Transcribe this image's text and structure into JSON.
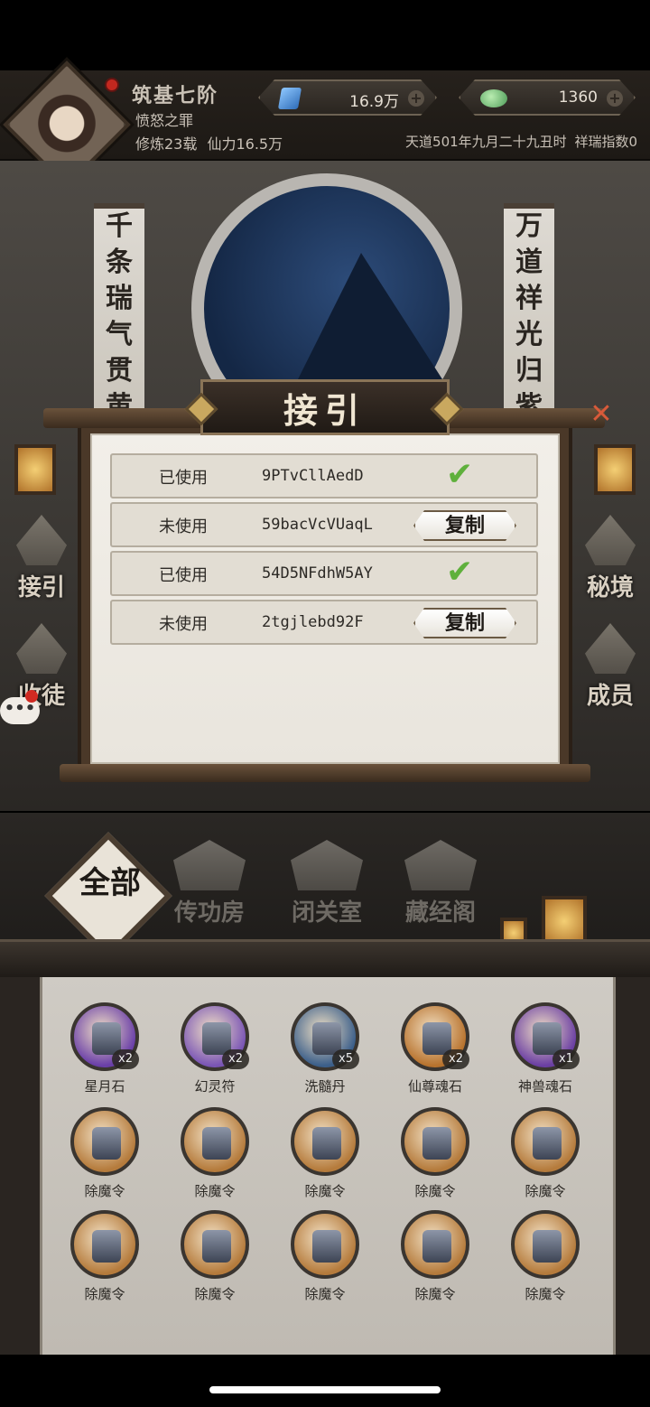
{
  "header": {
    "rank": "筑基七阶",
    "title": "愤怒之罪",
    "cultivation": "修炼23载",
    "power": "仙力16.5万",
    "date": "天道501年九月二十九丑时",
    "luck": "祥瑞指数0",
    "gems": "16.9万",
    "jade": "1360"
  },
  "scene": {
    "banner_left": [
      "千",
      "条",
      "瑞",
      "气",
      "贯",
      "黄"
    ],
    "banner_right": [
      "万",
      "道",
      "祥",
      "光",
      "归",
      "紫"
    ],
    "side_left": [
      "接引",
      "收徒"
    ],
    "side_right": [
      "秘境",
      "成员"
    ]
  },
  "dialog": {
    "title": "接引",
    "close": "✕",
    "rows": [
      {
        "status": "已使用",
        "code": "9PTvCllAedD",
        "used": true
      },
      {
        "status": "未使用",
        "code": "59bacVcVUaqL",
        "used": false
      },
      {
        "status": "已使用",
        "code": "54D5NFdhW5AY",
        "used": true
      },
      {
        "status": "未使用",
        "code": "2tgjlebd92F",
        "used": false
      }
    ],
    "copy_label": "复制",
    "check_icon": "✔"
  },
  "tabs": {
    "all": "全部",
    "items": [
      "传功房",
      "闭关室",
      "藏经阁"
    ]
  },
  "inventory": [
    {
      "name": "星月石",
      "count": "x2",
      "color": "#6a3fa8"
    },
    {
      "name": "幻灵符",
      "count": "x2",
      "color": "#7a55b5"
    },
    {
      "name": "洗髓丹",
      "count": "x5",
      "color": "#3c5f8a"
    },
    {
      "name": "仙尊魂石",
      "count": "x2",
      "color": "#b8732e"
    },
    {
      "name": "神兽魂石",
      "count": "x1",
      "color": "#6b3fa3"
    },
    {
      "name": "除魔令",
      "count": "",
      "color": "#b57b3c"
    },
    {
      "name": "除魔令",
      "count": "",
      "color": "#b57b3c"
    },
    {
      "name": "除魔令",
      "count": "",
      "color": "#b57b3c"
    },
    {
      "name": "除魔令",
      "count": "",
      "color": "#b57b3c"
    },
    {
      "name": "除魔令",
      "count": "",
      "color": "#b57b3c"
    },
    {
      "name": "除魔令",
      "count": "",
      "color": "#b57b3c"
    },
    {
      "name": "除魔令",
      "count": "",
      "color": "#b57b3c"
    },
    {
      "name": "除魔令",
      "count": "",
      "color": "#b57b3c"
    },
    {
      "name": "除魔令",
      "count": "",
      "color": "#b57b3c"
    },
    {
      "name": "除魔令",
      "count": "",
      "color": "#b57b3c"
    }
  ]
}
